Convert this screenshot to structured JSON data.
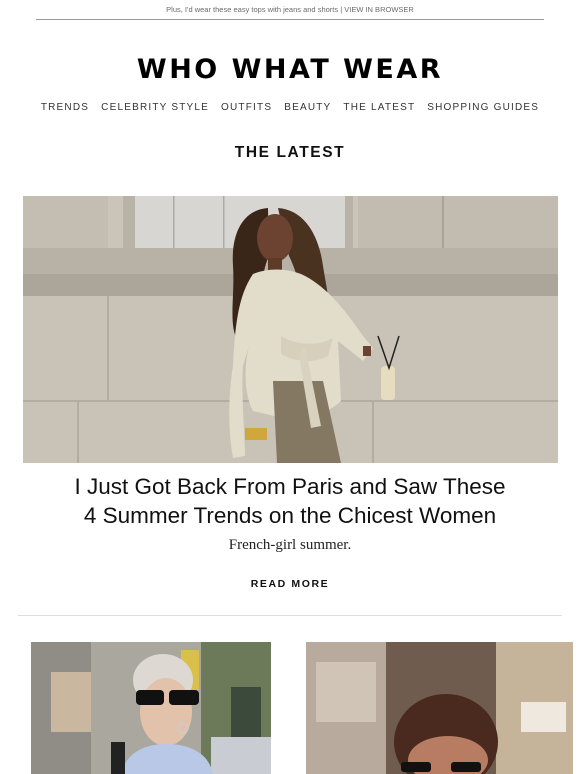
{
  "preheader": {
    "text": "Plus, I'd wear these easy tops with jeans and shorts | VIEW IN BROWSER"
  },
  "brand": {
    "logo_text": "WHO WHAT WEAR"
  },
  "nav": {
    "items": [
      "TRENDS",
      "CELEBRITY STYLE",
      "OUTFITS",
      "BEAUTY",
      "THE LATEST",
      "SHOPPING GUIDES"
    ]
  },
  "section": {
    "title": "THE LATEST"
  },
  "featured": {
    "headline_line1": "I Just Got Back From Paris and Saw These",
    "headline_line2": "4 Summer Trends on the Chicest Women",
    "dek": "French-girl summer.",
    "cta": "READ MORE"
  },
  "colors": {
    "stone_wall": "#cdc7bc",
    "trench": "#e2dccb",
    "skirt": "#857862",
    "hair": "#3a2618"
  }
}
